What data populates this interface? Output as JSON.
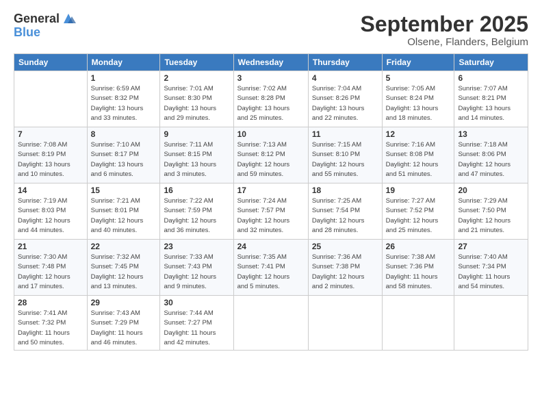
{
  "logo": {
    "general": "General",
    "blue": "Blue"
  },
  "header": {
    "title": "September 2025",
    "subtitle": "Olsene, Flanders, Belgium"
  },
  "weekdays": [
    "Sunday",
    "Monday",
    "Tuesday",
    "Wednesday",
    "Thursday",
    "Friday",
    "Saturday"
  ],
  "weeks": [
    [
      {
        "day": "",
        "info": ""
      },
      {
        "day": "1",
        "info": "Sunrise: 6:59 AM\nSunset: 8:32 PM\nDaylight: 13 hours\nand 33 minutes."
      },
      {
        "day": "2",
        "info": "Sunrise: 7:01 AM\nSunset: 8:30 PM\nDaylight: 13 hours\nand 29 minutes."
      },
      {
        "day": "3",
        "info": "Sunrise: 7:02 AM\nSunset: 8:28 PM\nDaylight: 13 hours\nand 25 minutes."
      },
      {
        "day": "4",
        "info": "Sunrise: 7:04 AM\nSunset: 8:26 PM\nDaylight: 13 hours\nand 22 minutes."
      },
      {
        "day": "5",
        "info": "Sunrise: 7:05 AM\nSunset: 8:24 PM\nDaylight: 13 hours\nand 18 minutes."
      },
      {
        "day": "6",
        "info": "Sunrise: 7:07 AM\nSunset: 8:21 PM\nDaylight: 13 hours\nand 14 minutes."
      }
    ],
    [
      {
        "day": "7",
        "info": "Sunrise: 7:08 AM\nSunset: 8:19 PM\nDaylight: 13 hours\nand 10 minutes."
      },
      {
        "day": "8",
        "info": "Sunrise: 7:10 AM\nSunset: 8:17 PM\nDaylight: 13 hours\nand 6 minutes."
      },
      {
        "day": "9",
        "info": "Sunrise: 7:11 AM\nSunset: 8:15 PM\nDaylight: 13 hours\nand 3 minutes."
      },
      {
        "day": "10",
        "info": "Sunrise: 7:13 AM\nSunset: 8:12 PM\nDaylight: 12 hours\nand 59 minutes."
      },
      {
        "day": "11",
        "info": "Sunrise: 7:15 AM\nSunset: 8:10 PM\nDaylight: 12 hours\nand 55 minutes."
      },
      {
        "day": "12",
        "info": "Sunrise: 7:16 AM\nSunset: 8:08 PM\nDaylight: 12 hours\nand 51 minutes."
      },
      {
        "day": "13",
        "info": "Sunrise: 7:18 AM\nSunset: 8:06 PM\nDaylight: 12 hours\nand 47 minutes."
      }
    ],
    [
      {
        "day": "14",
        "info": "Sunrise: 7:19 AM\nSunset: 8:03 PM\nDaylight: 12 hours\nand 44 minutes."
      },
      {
        "day": "15",
        "info": "Sunrise: 7:21 AM\nSunset: 8:01 PM\nDaylight: 12 hours\nand 40 minutes."
      },
      {
        "day": "16",
        "info": "Sunrise: 7:22 AM\nSunset: 7:59 PM\nDaylight: 12 hours\nand 36 minutes."
      },
      {
        "day": "17",
        "info": "Sunrise: 7:24 AM\nSunset: 7:57 PM\nDaylight: 12 hours\nand 32 minutes."
      },
      {
        "day": "18",
        "info": "Sunrise: 7:25 AM\nSunset: 7:54 PM\nDaylight: 12 hours\nand 28 minutes."
      },
      {
        "day": "19",
        "info": "Sunrise: 7:27 AM\nSunset: 7:52 PM\nDaylight: 12 hours\nand 25 minutes."
      },
      {
        "day": "20",
        "info": "Sunrise: 7:29 AM\nSunset: 7:50 PM\nDaylight: 12 hours\nand 21 minutes."
      }
    ],
    [
      {
        "day": "21",
        "info": "Sunrise: 7:30 AM\nSunset: 7:48 PM\nDaylight: 12 hours\nand 17 minutes."
      },
      {
        "day": "22",
        "info": "Sunrise: 7:32 AM\nSunset: 7:45 PM\nDaylight: 12 hours\nand 13 minutes."
      },
      {
        "day": "23",
        "info": "Sunrise: 7:33 AM\nSunset: 7:43 PM\nDaylight: 12 hours\nand 9 minutes."
      },
      {
        "day": "24",
        "info": "Sunrise: 7:35 AM\nSunset: 7:41 PM\nDaylight: 12 hours\nand 5 minutes."
      },
      {
        "day": "25",
        "info": "Sunrise: 7:36 AM\nSunset: 7:38 PM\nDaylight: 12 hours\nand 2 minutes."
      },
      {
        "day": "26",
        "info": "Sunrise: 7:38 AM\nSunset: 7:36 PM\nDaylight: 11 hours\nand 58 minutes."
      },
      {
        "day": "27",
        "info": "Sunrise: 7:40 AM\nSunset: 7:34 PM\nDaylight: 11 hours\nand 54 minutes."
      }
    ],
    [
      {
        "day": "28",
        "info": "Sunrise: 7:41 AM\nSunset: 7:32 PM\nDaylight: 11 hours\nand 50 minutes."
      },
      {
        "day": "29",
        "info": "Sunrise: 7:43 AM\nSunset: 7:29 PM\nDaylight: 11 hours\nand 46 minutes."
      },
      {
        "day": "30",
        "info": "Sunrise: 7:44 AM\nSunset: 7:27 PM\nDaylight: 11 hours\nand 42 minutes."
      },
      {
        "day": "",
        "info": ""
      },
      {
        "day": "",
        "info": ""
      },
      {
        "day": "",
        "info": ""
      },
      {
        "day": "",
        "info": ""
      }
    ]
  ]
}
